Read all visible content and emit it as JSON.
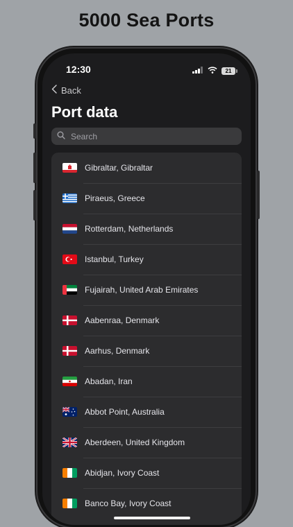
{
  "headline": "5000 Sea Ports",
  "status": {
    "time": "12:30",
    "battery": "21"
  },
  "nav": {
    "back_label": "Back"
  },
  "page": {
    "title": "Port data"
  },
  "search": {
    "placeholder": "Search"
  },
  "ports": [
    {
      "name": "Gibraltar, Gibraltar",
      "flag_icon": "gibraltar-flag-icon"
    },
    {
      "name": "Piraeus, Greece",
      "flag_icon": "greece-flag-icon"
    },
    {
      "name": "Rotterdam, Netherlands",
      "flag_icon": "netherlands-flag-icon"
    },
    {
      "name": "Istanbul, Turkey",
      "flag_icon": "turkey-flag-icon"
    },
    {
      "name": "Fujairah, United Arab Emirates",
      "flag_icon": "uae-flag-icon"
    },
    {
      "name": "Aabenraa, Denmark",
      "flag_icon": "denmark-flag-icon"
    },
    {
      "name": "Aarhus, Denmark",
      "flag_icon": "denmark-flag-icon"
    },
    {
      "name": "Abadan, Iran",
      "flag_icon": "iran-flag-icon"
    },
    {
      "name": "Abbot Point, Australia",
      "flag_icon": "australia-flag-icon"
    },
    {
      "name": "Aberdeen, United Kingdom",
      "flag_icon": "uk-flag-icon"
    },
    {
      "name": "Abidjan, Ivory Coast",
      "flag_icon": "ivory-coast-flag-icon"
    },
    {
      "name": "Banco Bay, Ivory Coast",
      "flag_icon": "ivory-coast-flag-icon"
    }
  ],
  "colors": {
    "screen_bg": "#1c1c1e",
    "list_bg": "#2c2c2e",
    "backdrop": "#9fa3a7"
  }
}
